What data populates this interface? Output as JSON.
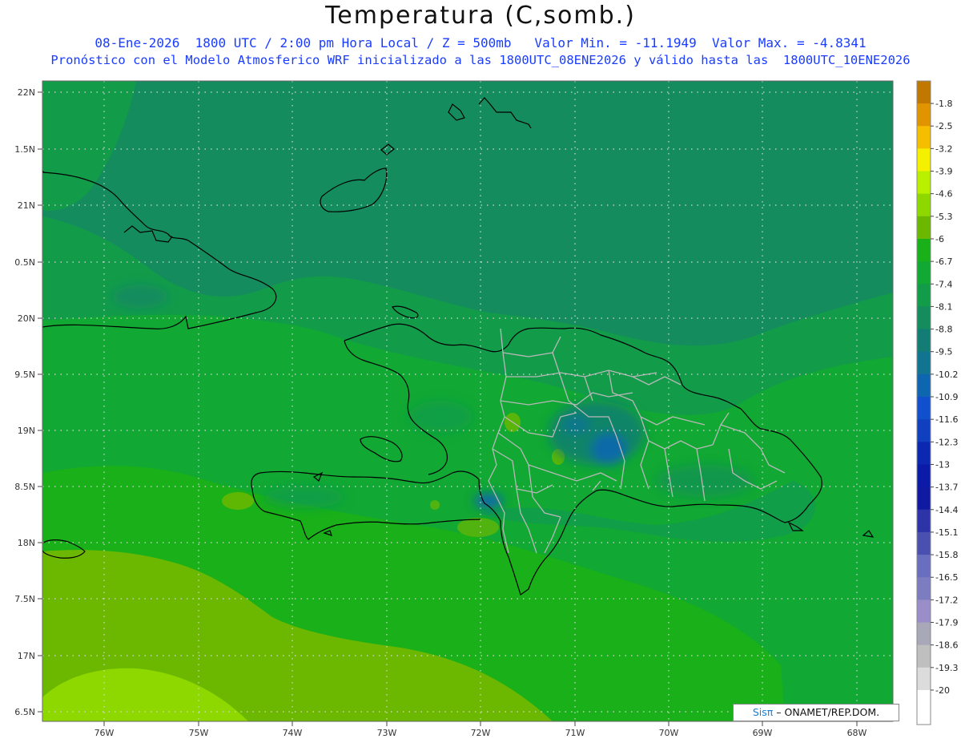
{
  "header": {
    "title": "Temperatura (C,somb.)",
    "line1": "08-Ene-2026  1800 UTC / 2:00 pm Hora Local / Z = 500mb   Valor Min. = -11.1949  Valor Max. = -4.8341",
    "line2": "Pronóstico con el Modelo Atmosferico WRF inicializado a las 1800UTC_08ENE2026 y válido hasta las  1800UTC_10ENE2026"
  },
  "map": {
    "lat_labels": [
      "22N",
      "1.5N",
      "21N",
      "0.5N",
      "20N",
      "9.5N",
      "19N",
      "8.5N",
      "18N",
      "7.5N",
      "17N",
      "6.5N"
    ],
    "lon_labels": [
      "76W",
      "75W",
      "74W",
      "73W",
      "72W",
      "71W",
      "70W",
      "69W",
      "68W"
    ]
  },
  "legend": {
    "labels": [
      "-1.8",
      "-2.5",
      "-3.2",
      "-3.9",
      "-4.6",
      "-5.3",
      "-6",
      "-6.7",
      "-7.4",
      "-8.1",
      "-8.8",
      "-9.5",
      "-10.2",
      "-10.9",
      "-11.6",
      "-12.3",
      "-13",
      "-13.7",
      "-14.4",
      "-15.1",
      "-15.8",
      "-16.5",
      "-17.2",
      "-17.9",
      "-18.6",
      "-19.3",
      "-20"
    ],
    "colors": [
      "#c07800",
      "#e09400",
      "#f5be00",
      "#f5f000",
      "#b8f000",
      "#8ed800",
      "#6cb800",
      "#19b019",
      "#11a833",
      "#129c4a",
      "#148c5e",
      "#137c74",
      "#117490",
      "#0f66b0",
      "#1050cc",
      "#1040c0",
      "#0c28b0",
      "#0c1aa8",
      "#101aa0",
      "#2c34a8",
      "#4a50b0",
      "#6a6ec0",
      "#7c7cc0",
      "#9a8ec8",
      "#a8a8b8",
      "#bfbfbf",
      "#dcdcdc"
    ],
    "top_color": "#c07800"
  },
  "credit": {
    "logo": "Sisπ",
    "text": "– ONAMET/REP.DOM."
  }
}
